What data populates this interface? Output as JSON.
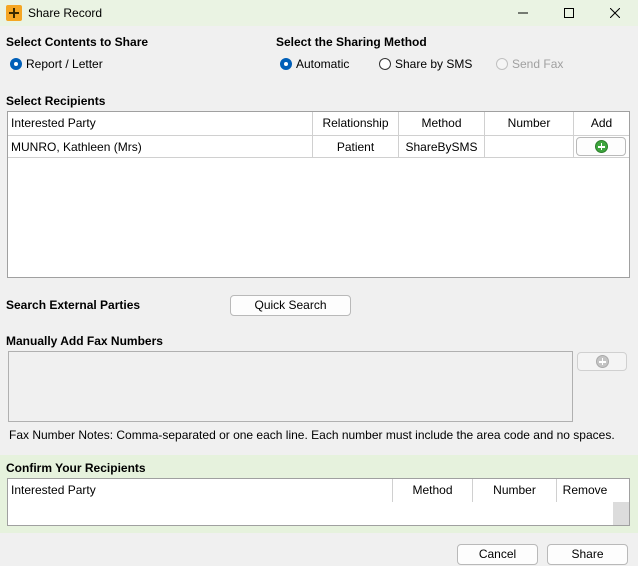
{
  "window": {
    "title": "Share Record"
  },
  "contents": {
    "heading": "Select Contents to Share",
    "option": "Report / Letter"
  },
  "sharing": {
    "heading": "Select the Sharing Method",
    "options": [
      "Automatic",
      "Share by SMS",
      "Send Fax"
    ]
  },
  "recipients": {
    "heading": "Select Recipients",
    "columns": [
      "Interested Party",
      "Relationship",
      "Method",
      "Number",
      "Add"
    ],
    "rows": [
      {
        "party": "MUNRO, Kathleen (Mrs)",
        "relationship": "Patient",
        "method": "ShareBySMS",
        "number": ""
      }
    ]
  },
  "search": {
    "heading": "Search External Parties",
    "button": "Quick Search"
  },
  "fax": {
    "heading": "Manually Add Fax Numbers",
    "note": "Fax Number Notes:  Comma-separated or one each line. Each number must include the area code and no spaces."
  },
  "confirm": {
    "heading": "Confirm Your Recipients",
    "columns": [
      "Interested Party",
      "Method",
      "Number",
      "Remove"
    ]
  },
  "footer": {
    "cancel": "Cancel",
    "share": "Share"
  },
  "colors": {
    "title_bg": "#eaf3e3",
    "confirm_bg": "#e6f2dd",
    "radio_accent": "#005fb8",
    "add_green": "#3da53d"
  }
}
